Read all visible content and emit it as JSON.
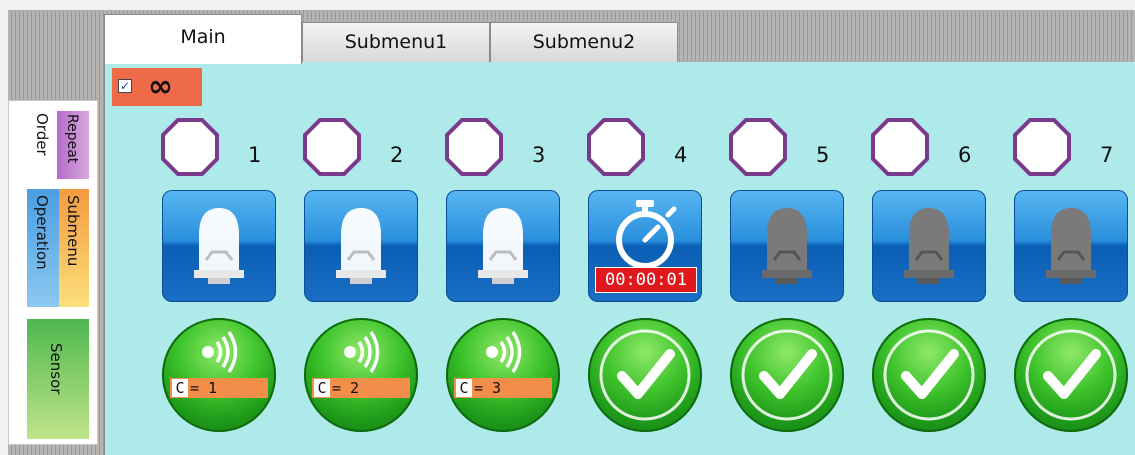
{
  "tabs": [
    {
      "label": "Main"
    },
    {
      "label": "Submenu1"
    },
    {
      "label": "Submenu2"
    }
  ],
  "loop": {
    "checked": true,
    "checkbox_mark": "✓",
    "symbol": "∞"
  },
  "palette": [
    {
      "label": "Order",
      "color": "#ffffff"
    },
    {
      "label": "Repeat",
      "color": "#c27ad0"
    },
    {
      "label": "Operation",
      "color": "#5aa8e4"
    },
    {
      "label": "Submenu",
      "color": "#f7b55a"
    },
    {
      "label": "Sensor",
      "color": "#5cc05c"
    }
  ],
  "steps": [
    {
      "number": "1",
      "light": "on",
      "action": "sensor",
      "counter_prefix": "C",
      "counter_value": "= 1"
    },
    {
      "number": "2",
      "light": "on",
      "action": "sensor",
      "counter_prefix": "C",
      "counter_value": "= 2"
    },
    {
      "number": "3",
      "light": "on",
      "action": "sensor",
      "counter_prefix": "C",
      "counter_value": "= 3"
    },
    {
      "number": "4",
      "light": "timer",
      "timer": "00:00:01",
      "action": "check"
    },
    {
      "number": "5",
      "light": "off",
      "action": "check"
    },
    {
      "number": "6",
      "light": "off",
      "action": "check"
    },
    {
      "number": "7",
      "light": "off",
      "action": "check"
    }
  ],
  "colors": {
    "panel": "#aeeaea",
    "loop_block": "#ef6a48",
    "octagon_stroke": "#7a3a8c",
    "tile_blue": "#1e7fd0",
    "timer_red": "#e0181c",
    "green": "#2fb52a",
    "counter_bar": "#f28d4a"
  },
  "icons": {
    "octagon": "octagon-icon",
    "light_on": "light-bulb-on-icon",
    "light_off": "light-bulb-off-icon",
    "timer": "stopwatch-icon",
    "sensor": "sensor-wave-icon",
    "check": "checkmark-icon"
  }
}
